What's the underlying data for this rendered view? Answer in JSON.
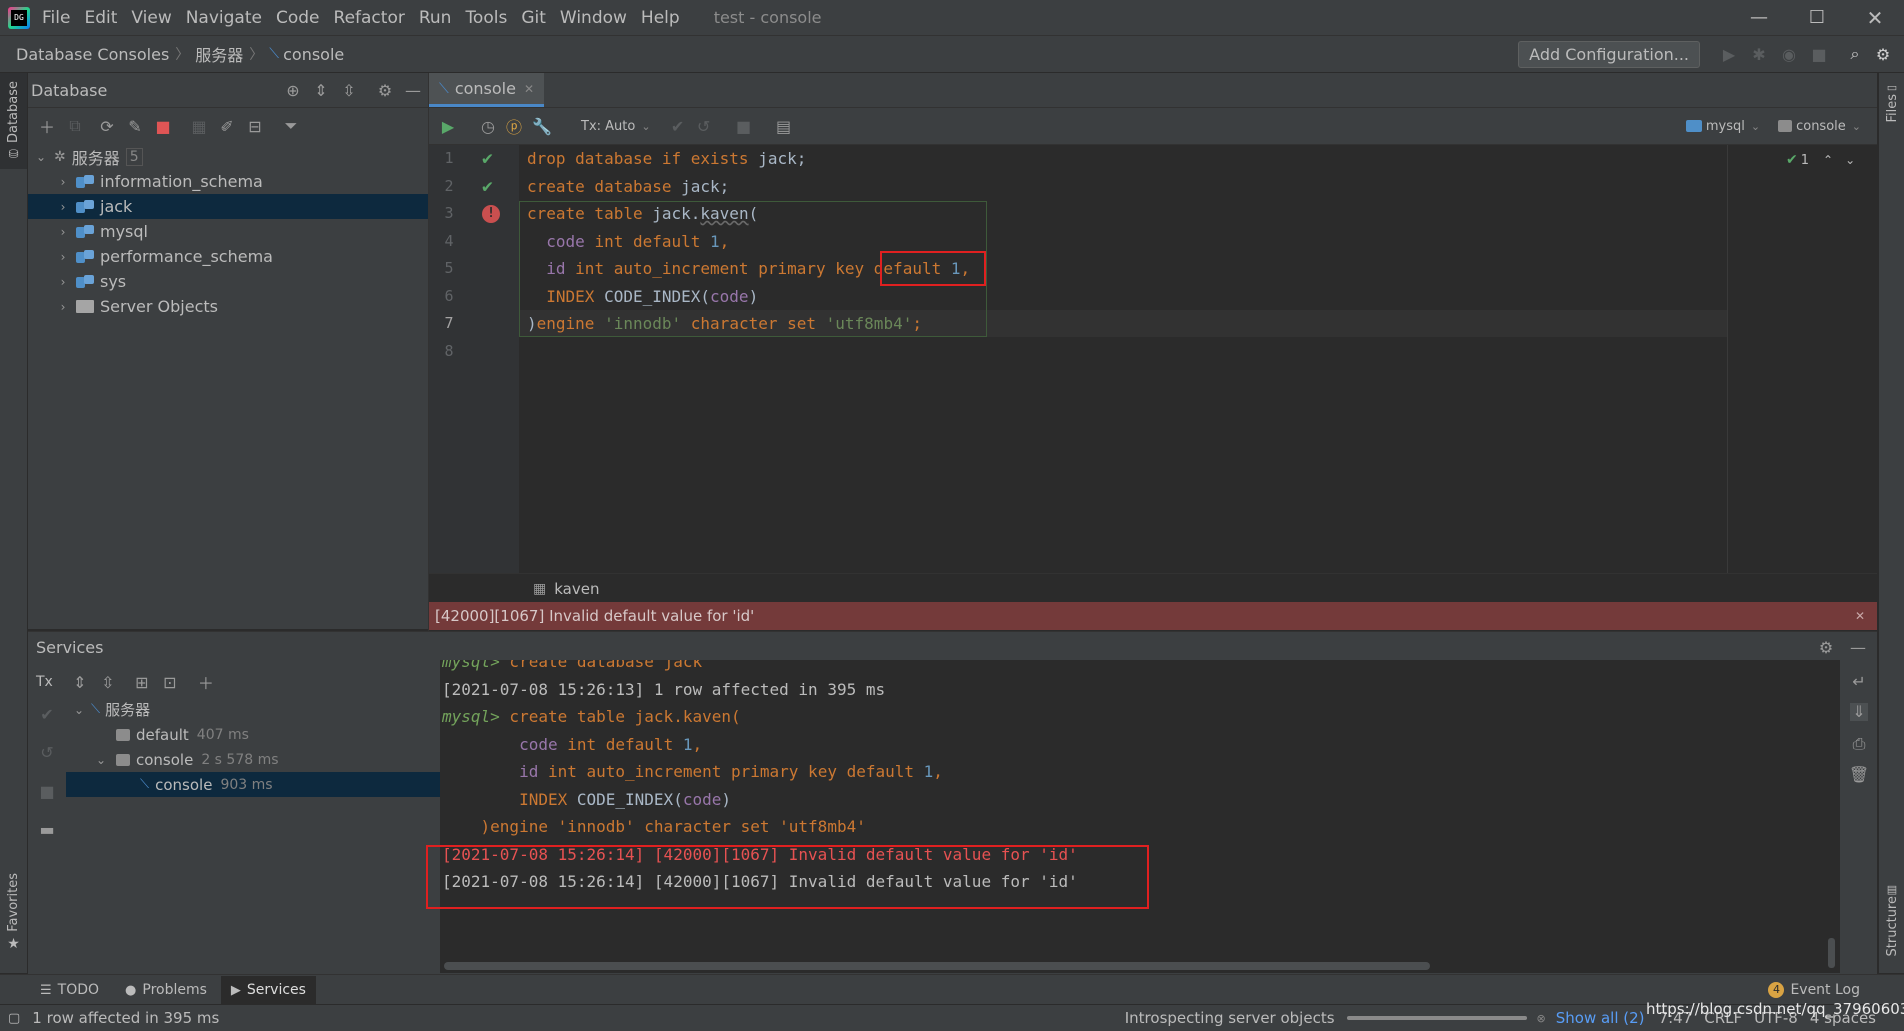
{
  "window": {
    "title": "test - console"
  },
  "menu": [
    "File",
    "Edit",
    "View",
    "Navigate",
    "Code",
    "Refactor",
    "Run",
    "Tools",
    "Git",
    "Window",
    "Help"
  ],
  "navbar": {
    "crumbs": [
      "Database Consoles",
      "服务器",
      "console"
    ],
    "add_config": "Add Configuration..."
  },
  "left_stripe": {
    "database": "Database",
    "favorites": "Favorites"
  },
  "right_stripe": {
    "files": "Files",
    "structure": "Structure"
  },
  "db_panel": {
    "title": "Database",
    "root": {
      "label": "服务器",
      "count": "5"
    },
    "items": [
      {
        "label": "information_schema"
      },
      {
        "label": "jack"
      },
      {
        "label": "mysql"
      },
      {
        "label": "performance_schema"
      },
      {
        "label": "sys"
      },
      {
        "label": "Server Objects"
      }
    ]
  },
  "editor": {
    "tab": "console",
    "tx_mode": "Tx: Auto",
    "datasource": "mysql",
    "session": "console",
    "check_count": "1",
    "line_numbers": [
      "1",
      "2",
      "3",
      "4",
      "5",
      "6",
      "7",
      "8"
    ],
    "breadcrumb": "kaven",
    "error": "[42000][1067] Invalid default value for 'id'"
  },
  "services": {
    "title": "Services",
    "tx_label": "Tx",
    "tree": {
      "root": "服务器",
      "default": {
        "label": "default",
        "time": "407 ms"
      },
      "console": {
        "label": "console",
        "time": "2 s 578 ms"
      },
      "session": {
        "label": "console",
        "time": "903 ms"
      }
    },
    "output": {
      "prompt": "mysql>",
      "cmd1": " create database jack",
      "result1": "[2021-07-08 15:26:13] 1 row affected in 395 ms",
      "cmd2": " create table jack.kaven(",
      "cmd2_line4": "    )engine 'innodb' character set 'utf8mb4'",
      "err1": "[2021-07-08 15:26:14] [42000][1067] Invalid default value for 'id'",
      "err2": "[2021-07-08 15:26:14] [42000][1067] Invalid default value for 'id'"
    }
  },
  "tool_tabs": {
    "todo": "TODO",
    "problems": "Problems",
    "services": "Services",
    "event_log": "Event Log",
    "event_count": "4"
  },
  "status": {
    "left": "1 row affected in 395 ms",
    "progress": "Introspecting server objects",
    "show_all": "Show all (2)",
    "position": "7:47",
    "line_sep": "CRLF",
    "encoding": "UTF-8",
    "indent": "4 spaces",
    "watermark": "https://blog.csdn.net/qq_37960603"
  },
  "colors": {
    "keyword": "#cc7832",
    "string": "#6a8759",
    "number": "#6897bb",
    "error_bar": "#743a3a",
    "selection": "#0d293e",
    "highlight_box": "#e02020"
  }
}
